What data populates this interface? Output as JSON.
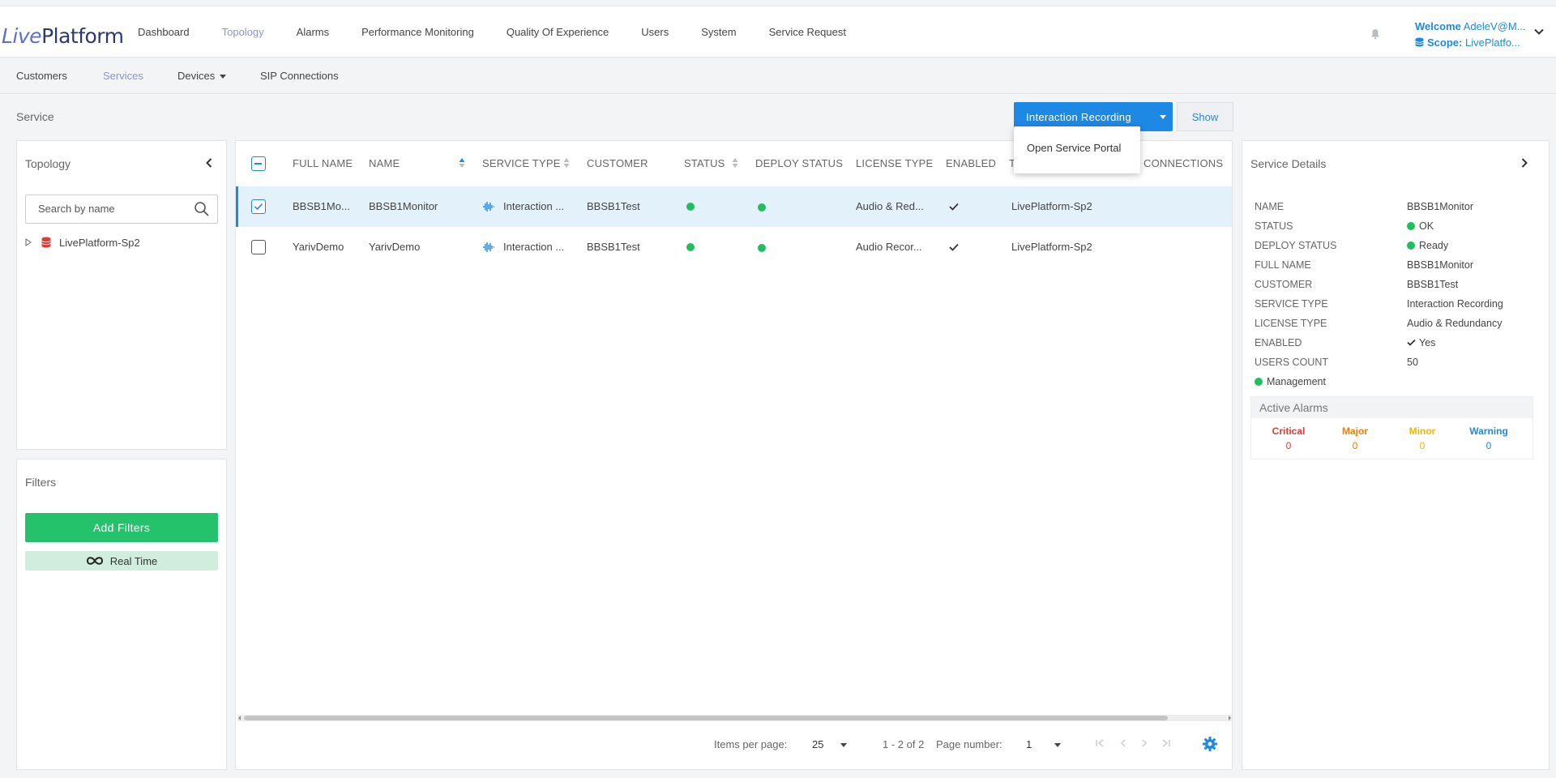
{
  "header": {
    "logo_live": "Live",
    "logo_platform": "Platform",
    "nav": [
      "Dashboard",
      "Topology",
      "Alarms",
      "Performance Monitoring",
      "Quality Of Experience",
      "Users",
      "System",
      "Service Request"
    ],
    "active_nav": "Topology",
    "welcome_label": "Welcome",
    "welcome_user": "AdeleV@M...",
    "scope_label": "Scope:",
    "scope_value": "LivePlatfo..."
  },
  "subnav": {
    "customers": "Customers",
    "services": "Services",
    "devices": "Devices",
    "sip": "SIP Connections"
  },
  "page": {
    "title": "Service",
    "service_button": "Interaction Recording",
    "show_button": "Show",
    "dropdown_item": "Open Service Portal"
  },
  "topology": {
    "title": "Topology",
    "search_placeholder": "Search by name",
    "tree_root": "LivePlatform-Sp2"
  },
  "filters": {
    "title": "Filters",
    "add_button": "Add Filters",
    "realtime": "Real Time"
  },
  "table": {
    "headers": [
      "FULL NAME",
      "NAME",
      "SERVICE TYPE",
      "CUSTOMER",
      "STATUS",
      "DEPLOY STATUS",
      "LICENSE TYPE",
      "ENABLED",
      "T",
      "CONNECTIONS"
    ],
    "rows": [
      {
        "full_name": "BBSB1Mo...",
        "name": "BBSB1Monitor",
        "service_type": "Interaction ...",
        "customer": "BBSB1Test",
        "license_type": "Audio & Red...",
        "topology": "LivePlatform-Sp2",
        "selected": true
      },
      {
        "full_name": "YarivDemo",
        "name": "YarivDemo",
        "service_type": "Interaction ...",
        "customer": "BBSB1Test",
        "license_type": "Audio Recor...",
        "topology": "LivePlatform-Sp2",
        "selected": false
      }
    ],
    "pager": {
      "items_per_page_label": "Items per page:",
      "items_per_page": "25",
      "range": "1 - 2 of 2",
      "page_number_label": "Page number:",
      "page_number": "1"
    }
  },
  "details": {
    "title": "Service Details",
    "rows": [
      {
        "label": "NAME",
        "value": "BBSB1Monitor"
      },
      {
        "label": "STATUS",
        "value": "OK"
      },
      {
        "label": "DEPLOY STATUS",
        "value": "Ready"
      },
      {
        "label": "FULL NAME",
        "value": "BBSB1Monitor"
      },
      {
        "label": "CUSTOMER",
        "value": "BBSB1Test"
      },
      {
        "label": "SERVICE TYPE",
        "value": "Interaction Recording"
      },
      {
        "label": "LICENSE TYPE",
        "value": "Audio & Redundancy"
      },
      {
        "label": "ENABLED",
        "value": "Yes"
      },
      {
        "label": "USERS COUNT",
        "value": "50"
      }
    ],
    "management": "Management",
    "alarms_title": "Active Alarms",
    "alarms": [
      {
        "name": "Critical",
        "count": "0",
        "color": "#e53935"
      },
      {
        "name": "Major",
        "count": "0",
        "color": "#f57c00"
      },
      {
        "name": "Minor",
        "count": "0",
        "color": "#f4b400"
      },
      {
        "name": "Warning",
        "count": "0",
        "color": "#1e88e5"
      }
    ]
  },
  "colors": {
    "primary": "#1e88e5",
    "success": "#24c36b",
    "active_nav": "#8a93d6"
  }
}
